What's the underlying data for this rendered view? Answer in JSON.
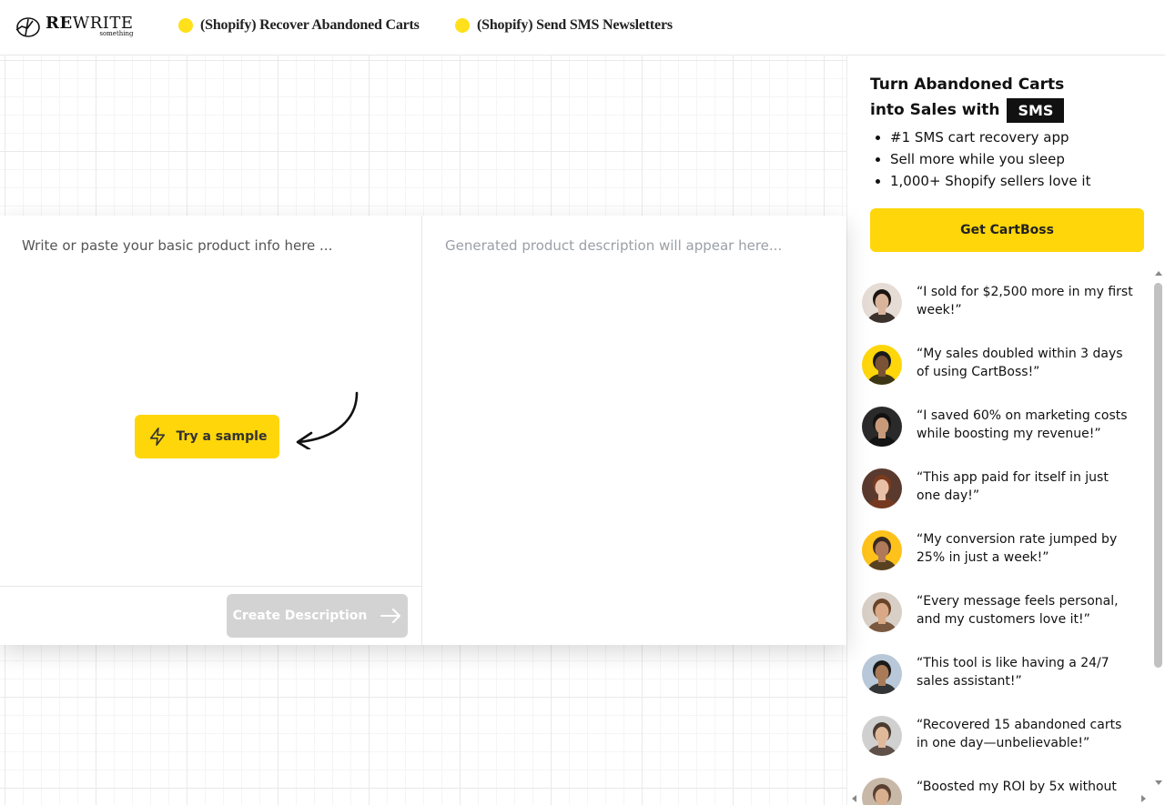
{
  "header": {
    "logo": {
      "main_bold": "RE",
      "main_light": "WRITE",
      "sub": "something"
    },
    "nav": [
      {
        "label": "(Shopify) Recover Abandoned Carts"
      },
      {
        "label": "(Shopify) Send SMS Newsletters"
      }
    ]
  },
  "editor": {
    "input_placeholder": "Write or paste your basic product info here ...",
    "output_placeholder": "Generated product description will appear here...",
    "sample_button": "Try a sample",
    "create_button": "Create Description"
  },
  "sidebar": {
    "promo": {
      "title_line1": "Turn Abandoned Carts",
      "title_line2": "into Sales with",
      "badge": "SMS",
      "bullets": [
        "#1 SMS cart recovery app",
        "Sell more while you sleep",
        "1,000+ Shopify sellers love it"
      ],
      "cta": "Get CartBoss"
    },
    "testimonials": [
      {
        "quote": "“I sold for $2,500 more in my first week!”",
        "avatar_bg": "#e6dcd6",
        "hair": "#1c1410",
        "skin": "#d9b39a"
      },
      {
        "quote": "“My sales doubled within 3 days of using CartBoss!”",
        "avatar_bg": "#ffd60a",
        "hair": "#1a1a1a",
        "skin": "#7a5236"
      },
      {
        "quote": "“I saved 60% on marketing costs while boosting my revenue!”",
        "avatar_bg": "#2a2a2a",
        "hair": "#111111",
        "skin": "#c89a7a"
      },
      {
        "quote": "“This app paid for itself in just one day!”",
        "avatar_bg": "#5a3a2e",
        "hair": "#7a3a1e",
        "skin": "#e8c0a8"
      },
      {
        "quote": "“My conversion rate jumped by 25% in just a week!”",
        "avatar_bg": "#ffc21a",
        "hair": "#3a2a22",
        "skin": "#b07a5a"
      },
      {
        "quote": "“Every message feels personal, and my customers love it!”",
        "avatar_bg": "#d8cfc6",
        "hair": "#6a4428",
        "skin": "#d9a886"
      },
      {
        "quote": "“This tool is like having a 24/7 sales assistant!”",
        "avatar_bg": "#b8c8d8",
        "hair": "#1a1a1a",
        "skin": "#a87a58"
      },
      {
        "quote": "“Recovered 15 abandoned carts in one day—unbelievable!”",
        "avatar_bg": "#d0d0d0",
        "hair": "#4a3a30",
        "skin": "#e0b89a"
      },
      {
        "quote": "“Boosted my ROI by 5x without",
        "avatar_bg": "#c8b8a8",
        "hair": "#5a4030",
        "skin": "#d8b090"
      }
    ]
  }
}
